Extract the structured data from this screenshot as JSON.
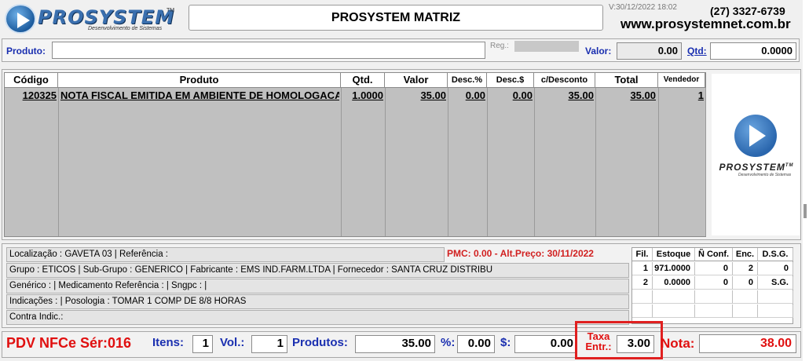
{
  "header": {
    "logo_text": "PROSYSTEM",
    "logo_tm": "TM",
    "logo_subtitle": "Desenvolvimento de Sistemas",
    "title": "PROSYSTEM MATRIZ",
    "version": "V:30/12/2022 18:02",
    "phone": "(27) 3327-6739",
    "website": "www.prosystemnet.com.br"
  },
  "product_bar": {
    "produto_label": "Produto:",
    "produto_value": "",
    "reg_label": "Reg.:",
    "valor_label": "Valor:",
    "valor_value": "0.00",
    "qtd_label": "Qtd:",
    "qtd_value": "0.0000"
  },
  "grid": {
    "headers": [
      "Código",
      "Produto",
      "Qtd.",
      "Valor",
      "Desc.%",
      "Desc.$",
      "c/Desconto",
      "Total",
      "Vendedor"
    ],
    "rows": [
      {
        "codigo": "120325",
        "produto": "NOTA FISCAL EMITIDA EM AMBIENTE DE HOMOLOGACAO",
        "qtd": "1.0000",
        "valor": "35.00",
        "desc_pct": "0.00",
        "desc_val": "0.00",
        "c_desconto": "35.00",
        "total": "35.00",
        "vendedor": "1"
      }
    ]
  },
  "side_logo": {
    "text": "PROSYSTEM",
    "tm": "TM",
    "subtitle": "Desenvolvimento de Sistemas"
  },
  "info": {
    "localizacao": "Localização : GAVETA 03  |  Referência :",
    "pmc": "PMC:     0.00 - Alt.Preço: 30/11/2022",
    "grupo": "Grupo : ETICOS  |  Sub-Grupo : GENERICO  |  Fabricante : EMS IND.FARM.LTDA  |  Fornecedor : SANTA CRUZ  DISTRIBU",
    "generico": "Genérico :  |  Medicamento Referência :  |  Sngpc :  |",
    "indicacoes": "Indicações :  |  Posologia : TOMAR 1 COMP DE 8/8 HORAS",
    "contra_indic": "Contra Indic.:"
  },
  "stock": {
    "headers": [
      "Fil.",
      "Estoque",
      "Ñ Conf.",
      "Enc.",
      "D.S.G."
    ],
    "rows": [
      [
        "1",
        "971.0000",
        "0",
        "2",
        "0"
      ],
      [
        "2",
        "0.0000",
        "0",
        "0",
        "S.G."
      ]
    ]
  },
  "bottom": {
    "pdv": "PDV NFCe Sér:016",
    "itens_label": "Itens:",
    "itens_value": "1",
    "vol_label": "Vol.:",
    "vol_value": "1",
    "produtos_label": "Produtos:",
    "produtos_value": "35.00",
    "pct_label": "%:",
    "pct_value": "0.00",
    "dollar_label": "$:",
    "dollar_value": "0.00",
    "taxa_label": "Taxa Entr.:",
    "taxa_value": "3.00",
    "nota_label": "Nota:",
    "nota_value": "38.00"
  },
  "colors": {
    "label_blue": "#1a2fb0",
    "alert_red": "#e01010",
    "grid_gray": "#c0c0c0"
  }
}
